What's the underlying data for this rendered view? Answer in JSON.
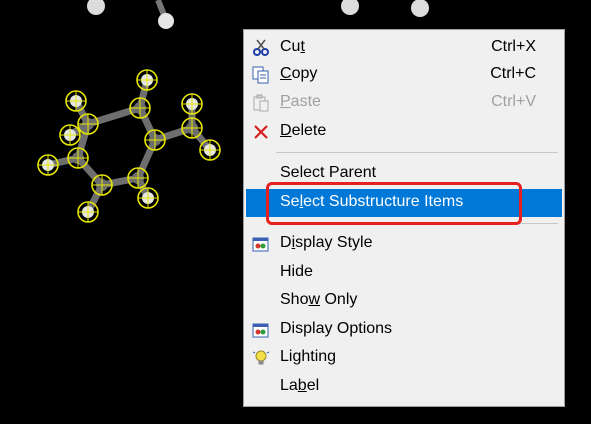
{
  "menu": {
    "items": [
      {
        "pre": "Cu",
        "acc": "t",
        "post": "",
        "shortcut": "Ctrl+X",
        "icon": "scissors-icon",
        "state": "enabled"
      },
      {
        "pre": "",
        "acc": "C",
        "post": "opy",
        "shortcut": "Ctrl+C",
        "icon": "copy-icon",
        "state": "enabled"
      },
      {
        "pre": "",
        "acc": "P",
        "post": "aste",
        "shortcut": "Ctrl+V",
        "icon": "paste-icon",
        "state": "disabled"
      },
      {
        "pre": "",
        "acc": "D",
        "post": "elete",
        "shortcut": "",
        "icon": "delete-x-icon",
        "state": "enabled"
      },
      {
        "pre": "Select Parent",
        "acc": "",
        "post": "",
        "shortcut": "",
        "icon": "",
        "state": "enabled"
      },
      {
        "pre": "Se",
        "acc": "l",
        "post": "ect Substructure Items",
        "shortcut": "",
        "icon": "",
        "state": "selected"
      },
      {
        "pre": "D",
        "acc": "i",
        "post": "splay Style",
        "shortcut": "",
        "icon": "display-style-icon",
        "state": "enabled"
      },
      {
        "pre": "Hide",
        "acc": "",
        "post": "",
        "shortcut": "",
        "icon": "",
        "state": "enabled"
      },
      {
        "pre": "Sho",
        "acc": "w",
        "post": " Only",
        "shortcut": "",
        "icon": "",
        "state": "enabled"
      },
      {
        "pre": "Display Options",
        "acc": "",
        "post": "",
        "shortcut": "",
        "icon": "display-options-icon",
        "state": "enabled"
      },
      {
        "pre": "Li",
        "acc": "g",
        "post": "hting",
        "shortcut": "",
        "icon": "lightbulb-icon",
        "state": "enabled"
      },
      {
        "pre": "La",
        "acc": "b",
        "post": "el",
        "shortcut": "",
        "icon": "",
        "state": "enabled"
      }
    ]
  },
  "colors": {
    "background": "#000000",
    "menu_background": "#f0f0f0",
    "selection": "#0078d7",
    "highlight_annotation": "#e62020",
    "atom_selection_ring": "#e6e600",
    "carbon": "#6e6e6e",
    "hydrogen": "#e6e6e6"
  }
}
